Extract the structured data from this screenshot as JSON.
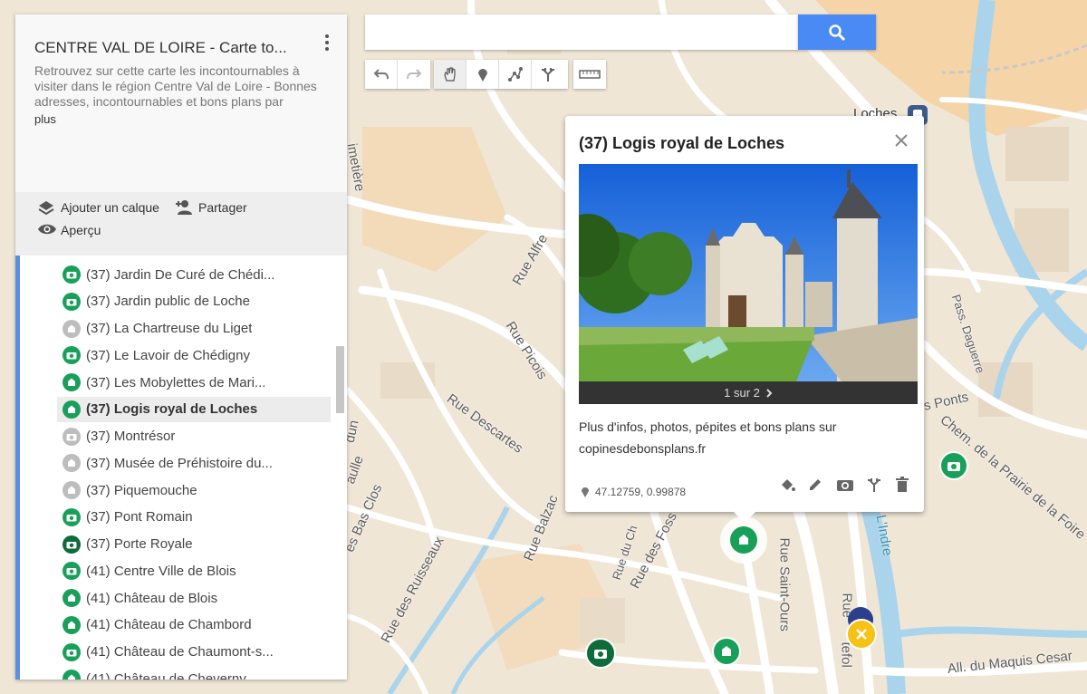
{
  "map_panel": {
    "title": "CENTRE VAL DE LOIRE - Carte to...",
    "description": "Retrouvez sur cette carte les incontournables à visiter dans le région Centre Val de Loire - Bonnes adresses, incontournables et bons plans par",
    "more_link": "plus",
    "actions": {
      "add_layer": "Ajouter un calque",
      "share": "Partager",
      "preview": "Aperçu"
    },
    "items": [
      {
        "label": "(37) Jardin De Curé de Chédi...",
        "icon": "camera-icon",
        "color": "green"
      },
      {
        "label": "(37) Jardin public de Loche",
        "icon": "camera-icon",
        "color": "green"
      },
      {
        "label": "(37) La Chartreuse du Liget",
        "icon": "monument-icon",
        "color": "gray"
      },
      {
        "label": "(37) Le Lavoir de Chédigny",
        "icon": "camera-icon",
        "color": "green"
      },
      {
        "label": "(37) Les Mobylettes de Mari...",
        "icon": "monument-icon",
        "color": "green"
      },
      {
        "label": "(37) Logis royal de Loches",
        "icon": "monument-icon",
        "color": "green",
        "selected": true
      },
      {
        "label": "(37) Montrésor",
        "icon": "camera-icon",
        "color": "gray"
      },
      {
        "label": "(37) Musée de Préhistoire du...",
        "icon": "monument-icon",
        "color": "gray"
      },
      {
        "label": "(37) Piquemouche",
        "icon": "monument-icon",
        "color": "gray"
      },
      {
        "label": "(37) Pont Romain",
        "icon": "camera-icon",
        "color": "green"
      },
      {
        "label": "(37) Porte Royale",
        "icon": "camera-icon",
        "color": "darkgreen"
      },
      {
        "label": "(41) Centre Ville de Blois",
        "icon": "camera-icon",
        "color": "green"
      },
      {
        "label": "(41) Château de Blois",
        "icon": "monument-icon",
        "color": "green"
      },
      {
        "label": "(41) Château de Chambord",
        "icon": "monument-icon",
        "color": "green"
      },
      {
        "label": "(41) Château de Chaumont-s...",
        "icon": "camera-icon",
        "color": "green"
      },
      {
        "label": "(41) Château de Cheverny",
        "icon": "monument-icon",
        "color": "green"
      }
    ]
  },
  "search": {
    "value": "",
    "placeholder": ""
  },
  "toolbar": [
    "undo-icon",
    "redo-icon",
    "hand-icon",
    "marker-icon",
    "line-icon",
    "directions-icon",
    "ruler-icon"
  ],
  "popup": {
    "title": "(37) Logis royal de Loches",
    "photo_nav": "1 sur 2",
    "description_line1": "Plus d'infos, photos, pépites et bons plans sur",
    "description_line2": "copinesdebonsplans.fr",
    "coordinates": "47.12759, 0.99878"
  },
  "streets": {
    "rue_alfred": "Rue Alfre",
    "rue_picois": "Rue Picois",
    "rue_descartes": "Rue Descartes",
    "rue_balzac": "Rue Balzac",
    "rue_du_ch": "Rue du Ch",
    "rue_des_foss": "Rue des Foss",
    "rue_saint_ours": "Rue Saint-Ours",
    "rue_des_ruisseaux": "Rue des Ruisseaux",
    "bas_clos": "es Bas Clos",
    "cimetiere": "imetière",
    "pass_daguerre": "Pass. Daguerre",
    "ponts": "s Ponts",
    "chem_prairie": "Chem. de la Prairie de la Foire",
    "indre": "L'Indre",
    "maquis": "All. du Maquis Cesar",
    "loches": "Loches",
    "rue_frag": "Rue",
    "rtefol": "tefol",
    "dun": "dun",
    "aulle": "aulle"
  },
  "colors": {
    "accent": "#4a8af4",
    "marker_green": "#18a05a",
    "land": "#efe6d6",
    "road": "#ffffff",
    "river": "#a9d4ec"
  }
}
